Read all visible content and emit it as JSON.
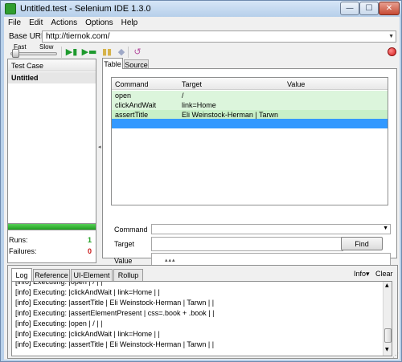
{
  "window": {
    "title": "Untitled.test - Selenium IDE 1.3.0",
    "minimize": "—",
    "maximize": "☐",
    "close": "✕"
  },
  "menu": {
    "items": [
      "File",
      "Edit",
      "Actions",
      "Options",
      "Help"
    ]
  },
  "base_url": {
    "label": "Base URL",
    "value": "http://tiernok.com/"
  },
  "toolbar": {
    "speed_fast": "Fast",
    "speed_slow": "Slow",
    "speed_level": 0.05,
    "icons": [
      "play-suite-icon",
      "play-test-icon",
      "pause-icon",
      "step-icon",
      "rollup-icon",
      "record-icon"
    ]
  },
  "test_case_panel": {
    "header": "Test Case",
    "items": [
      "Untitled"
    ]
  },
  "stats": {
    "runs_label": "Runs:",
    "runs_value": "1",
    "failures_label": "Failures:",
    "failures_value": "0",
    "progress": 1.0,
    "success_color": "#1f9e1f",
    "failure_color": "#c81414"
  },
  "editor": {
    "tabs": [
      "Table",
      "Source"
    ],
    "columns": [
      "Command",
      "Target",
      "Value"
    ],
    "rows": [
      {
        "command": "open",
        "target": "/",
        "value": ""
      },
      {
        "command": "clickAndWait",
        "target": "link=Home",
        "value": ""
      },
      {
        "command": "assertTitle",
        "target": "Eli Weinstock-Herman | Tarwn",
        "value": ""
      }
    ],
    "command_label": "Command",
    "target_label": "Target",
    "value_label": "Value",
    "find_button": "Find",
    "pass_row_color": "#dcf5dc",
    "selected_row_color": "#3399ff"
  },
  "log_panel": {
    "tabs": [
      "Log",
      "Reference",
      "UI-Element",
      "Rollup"
    ],
    "info_button": "Info▾",
    "clear_button": "Clear",
    "lines": [
      "[info] Executing: |open | / | |",
      "[info] Executing: |clickAndWait | link=Home | |",
      "[info] Executing: |assertTitle | Eli Weinstock-Herman | Tarwn | |",
      "[info] Executing: |assertElementPresent | css=.book + .book | |",
      "[info] Executing: |open | / | |",
      "[info] Executing: |clickAndWait | link=Home | |",
      "[info] Executing: |assertTitle | Eli Weinstock-Herman | Tarwn | |"
    ]
  }
}
